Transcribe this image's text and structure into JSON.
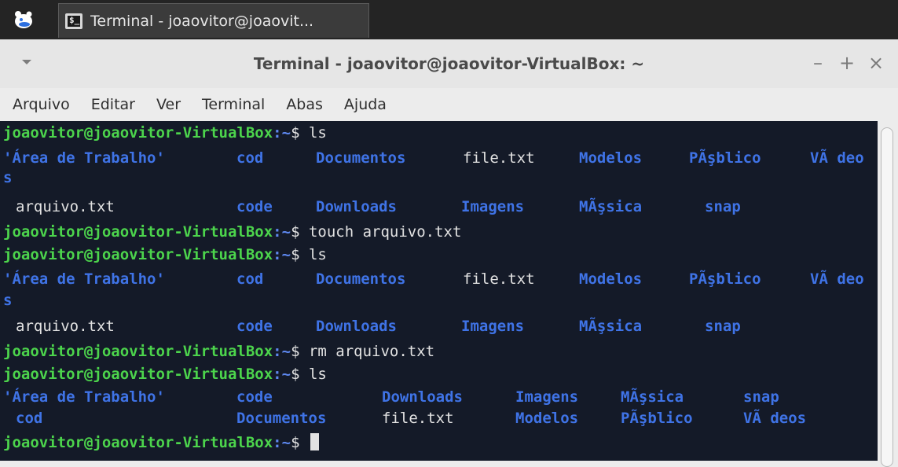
{
  "taskbar": {
    "start_icon": "xfce-mouse-icon",
    "task_label": "Terminal - joaovitor@joaovit...",
    "task_icon": "terminal-icon",
    "task_icon_glyph": "$_"
  },
  "window": {
    "title": "Terminal - joaovitor@joaovitor-VirtualBox: ~",
    "controls": {
      "minimize": "–",
      "maximize": "+",
      "close": "×"
    }
  },
  "menubar": {
    "items": [
      "Arquivo",
      "Editar",
      "Ver",
      "Terminal",
      "Abas",
      "Ajuda"
    ]
  },
  "terminal": {
    "prompt_user": "joaovitor@joaovitor-VirtualBox",
    "prompt_path": ":~",
    "prompt_symbol": "$",
    "commands": [
      "ls",
      "touch arquivo.txt",
      "ls",
      "rm arquivo.txt",
      "ls"
    ],
    "ls_output_1": {
      "row1": [
        "'Área de Trabalho'",
        "cod",
        "Documentos",
        "file.txt",
        "Modelos",
        "PÃşblico",
        "VÃ deo"
      ],
      "wrap": "s",
      "row2": [
        "arquivo.txt",
        "code",
        "Downloads",
        "Imagens",
        "MÃşsica",
        "snap"
      ]
    },
    "ls_output_2": {
      "row1": [
        "'Área de Trabalho'",
        "cod",
        "Documentos",
        "file.txt",
        "Modelos",
        "PÃşblico",
        "VÃ deo"
      ],
      "wrap": "s",
      "row2": [
        "arquivo.txt",
        "code",
        "Downloads",
        "Imagens",
        "MÃşsica",
        "snap"
      ]
    },
    "ls_output_3": {
      "row1": [
        "'Área de Trabalho'",
        "code",
        "Downloads",
        "Imagens",
        "MÃşsica",
        "snap"
      ],
      "row2": [
        "cod",
        "Documentos",
        "file.txt",
        "Modelos",
        "PÃşblico",
        "VÃ deos"
      ]
    }
  },
  "colors": {
    "terminal_bg": "#141a28",
    "prompt_user": "#4cd44c",
    "directory": "#3f73e6",
    "text": "#e2e2e2"
  }
}
